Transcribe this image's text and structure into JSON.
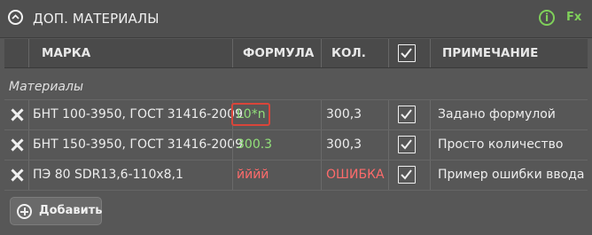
{
  "panel": {
    "title": "ДОП. МАТЕРИАЛЫ",
    "info_icon": "info-icon",
    "fx_label": "Fx"
  },
  "columns": {
    "marka": "МАРКА",
    "formula": "ФОРМУЛА",
    "qty": "КОЛ.",
    "note": "ПРИМЕЧАНИЕ"
  },
  "group_label": "Материалы",
  "rows": [
    {
      "marka": "БНТ 100-3950, ГОСТ 31416-2009",
      "formula": "L0*n",
      "qty": "300,3",
      "checked": true,
      "note": "Задано формулой"
    },
    {
      "marka": "БНТ 150-3950, ГОСТ 31416-2009",
      "formula": "300.3",
      "qty": "300,3",
      "checked": true,
      "note": "Просто количество"
    },
    {
      "marka": "ПЭ 80 SDR13,6-110х8,1",
      "formula": "йййй",
      "qty": "ОШИБКА",
      "checked": true,
      "note": "Пример ошибки ввода"
    }
  ],
  "add_button": {
    "label": "Добавить"
  },
  "colors": {
    "formula_ok": "#92e07a",
    "error": "#ff6b6b",
    "focus_border": "#d9453a",
    "accent": "#7fd05a"
  }
}
